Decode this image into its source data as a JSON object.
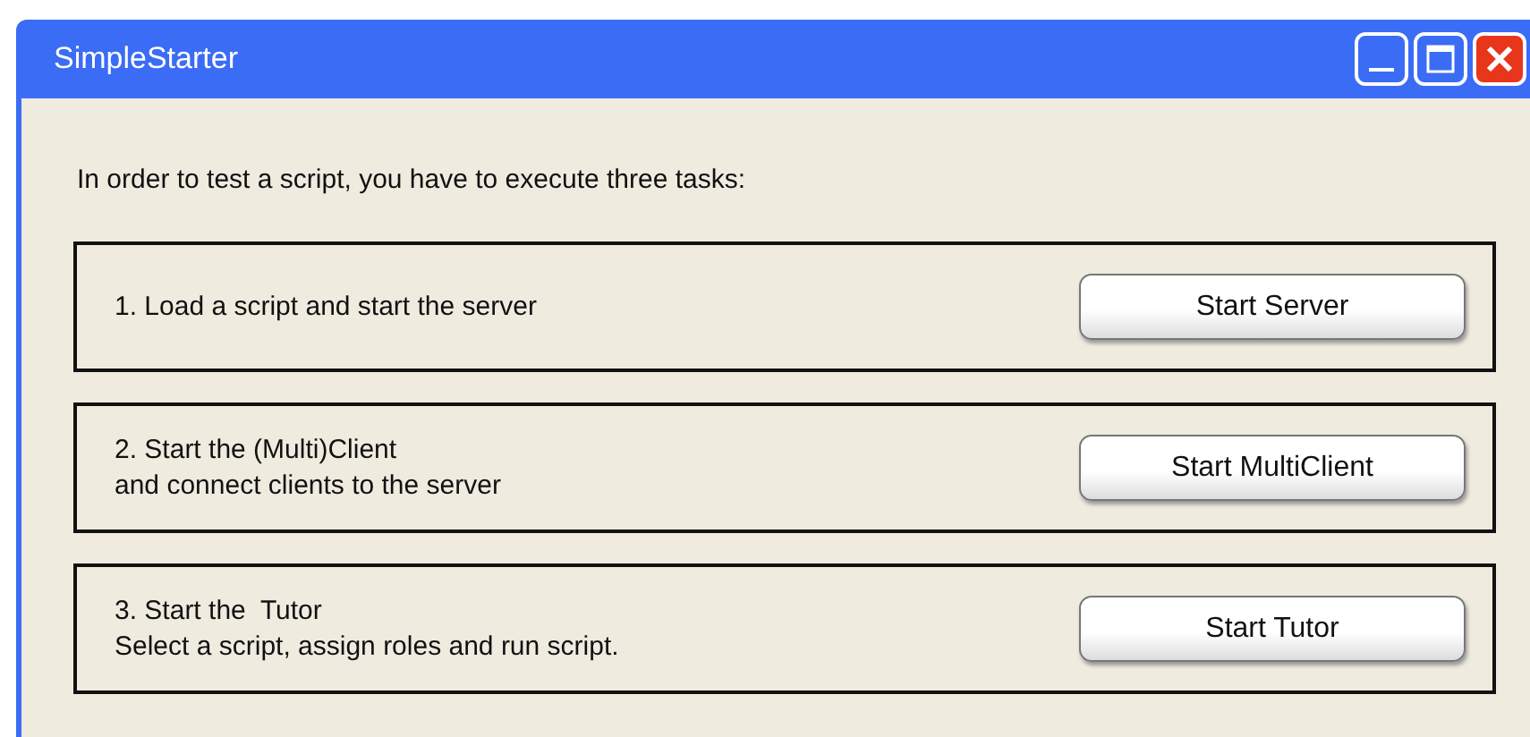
{
  "window": {
    "title": "SimpleStarter"
  },
  "intro": "In order to test a script, you have to execute three tasks:",
  "tasks": [
    {
      "lines": [
        "1. Load a script and start the server"
      ],
      "button": "Start Server"
    },
    {
      "lines": [
        "2. Start the (Multi)Client",
        "and connect clients to the server"
      ],
      "button": "Start MultiClient"
    },
    {
      "lines": [
        "3. Start the  Tutor",
        "Select a script, assign roles and run script."
      ],
      "button": "Start Tutor"
    }
  ]
}
